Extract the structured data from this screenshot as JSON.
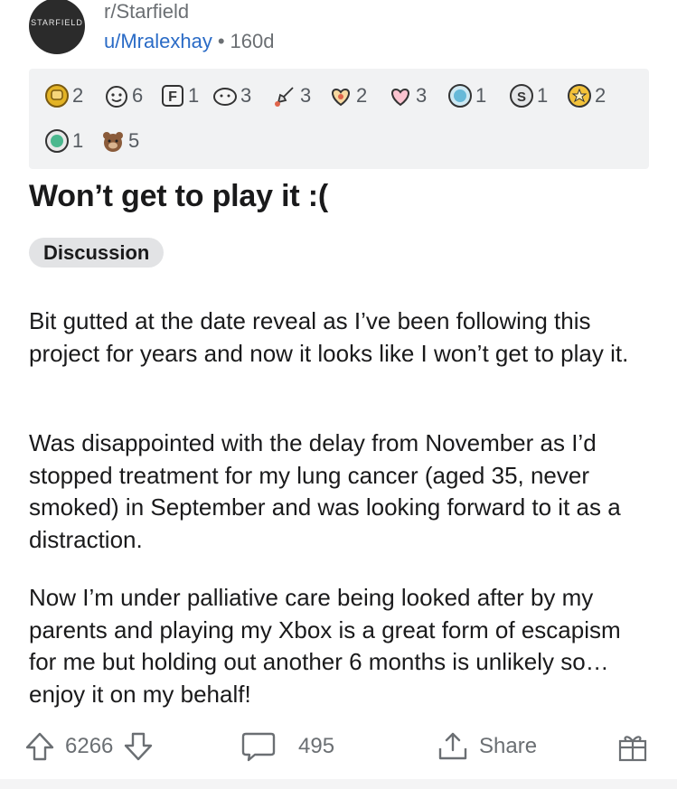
{
  "header": {
    "subreddit": "r/Starfield",
    "logo_text": "STARFIELD",
    "username": "u/Mralexhay",
    "separator": "•",
    "age": "160d"
  },
  "awards": [
    {
      "name": "helpful-hand-award-icon",
      "count": "2",
      "color": "#e3b325"
    },
    {
      "name": "wholesome-award-icon",
      "count": "6",
      "color": "#f5f5f5"
    },
    {
      "name": "press-f-award-icon",
      "count": "1",
      "color": "#f5f5f5"
    },
    {
      "name": "take-my-energy-award-icon",
      "count": "3",
      "color": "#f5f5f5"
    },
    {
      "name": "rocket-award-icon",
      "count": "3",
      "color": "#e0654b"
    },
    {
      "name": "heart-award-icon",
      "count": "2",
      "color": "#f4b340"
    },
    {
      "name": "hug-award-icon",
      "count": "3",
      "color": "#f25a7a"
    },
    {
      "name": "platinum-award-icon",
      "count": "1",
      "color": "#67b9d8"
    },
    {
      "name": "silver-award-icon",
      "count": "1",
      "color": "#c0c4c8"
    },
    {
      "name": "gold-award-icon",
      "count": "2",
      "color": "#f3c23a"
    },
    {
      "name": "mod-badge-award-icon",
      "count": "1",
      "color": "#4bb88e"
    },
    {
      "name": "bear-award-icon",
      "count": "5",
      "color": "#8a5b3a"
    }
  ],
  "post": {
    "title": "Won’t get to play it :(",
    "flair": "Discussion",
    "paragraphs": [
      "Bit gutted at the date reveal as I’ve been following this project for years and now it looks like I won’t get to play it.",
      "Was disappointed with the delay from November as I’d stopped treatment for my lung cancer (aged 35, never smoked) in September and was looking forward to it as a distraction.",
      "Now I’m under palliative care being looked after by my parents and playing my Xbox is a great form of escapism for me but holding out another 6 months is unlikely so… enjoy it on my behalf!"
    ]
  },
  "actions": {
    "upvotes": "6266",
    "comments": "495",
    "share_label": "Share"
  }
}
